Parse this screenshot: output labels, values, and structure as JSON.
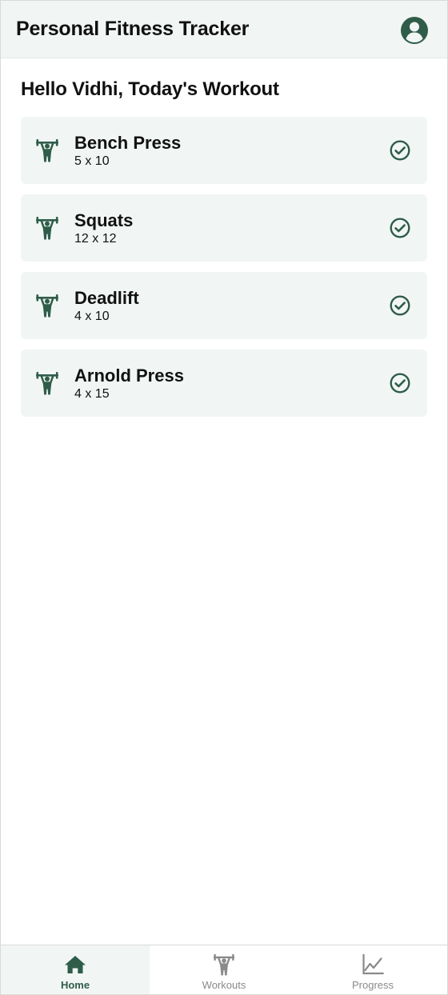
{
  "header": {
    "title": "Personal Fitness Tracker",
    "profile_icon": "user-circle-icon"
  },
  "greeting": "Hello Vidhi, Today's Workout",
  "workouts": [
    {
      "name": "Bench Press",
      "sets": "5 x 10",
      "icon": "weightlifter-icon",
      "status_icon": "check-circle-icon"
    },
    {
      "name": "Squats",
      "sets": "12 x 12",
      "icon": "weightlifter-icon",
      "status_icon": "check-circle-icon"
    },
    {
      "name": "Deadlift",
      "sets": "4 x 10",
      "icon": "weightlifter-icon",
      "status_icon": "check-circle-icon"
    },
    {
      "name": "Arnold Press",
      "sets": "4 x 15",
      "icon": "weightlifter-icon",
      "status_icon": "check-circle-icon"
    }
  ],
  "nav": {
    "active": "Home",
    "tabs": [
      {
        "label": "Home",
        "icon": "home-icon"
      },
      {
        "label": "Workouts",
        "icon": "weightlifter-icon"
      },
      {
        "label": "Progress",
        "icon": "line-chart-icon"
      }
    ]
  },
  "colors": {
    "accent": "#2f5d4a",
    "card_background": "#f1f6f4",
    "inactive_nav": "#8a8a8a"
  }
}
